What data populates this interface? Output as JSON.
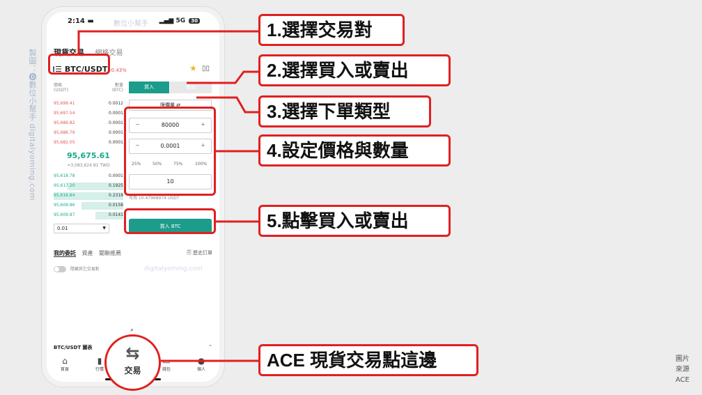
{
  "side_watermark": "製圖：🅓數位小幫手 digitalyoming.com",
  "status": {
    "time": "2:14 ▬",
    "brand": "數位小幫手",
    "signal": "▂▄▆ 5G",
    "battery": "30"
  },
  "tabs": {
    "spot": "現貨交易",
    "grid": "網格交易"
  },
  "pair": {
    "symbol": "⁞☰ BTC/USDT",
    "change": "-0.43%"
  },
  "icons": {
    "favorite": "star-icon",
    "chart": "candlestick-icon"
  },
  "orderbook": {
    "header": {
      "price": "價格",
      "price_unit": "(USDT)",
      "qty": "數量",
      "qty_unit": "(BTC)"
    },
    "sells": [
      {
        "price": "95,699.41",
        "qty": "0.0012"
      },
      {
        "price": "95,697.54",
        "qty": "0.0001"
      },
      {
        "price": "95,686.82",
        "qty": "0.0001"
      },
      {
        "price": "95,686.79",
        "qty": "0.0001"
      },
      {
        "price": "95,682.05",
        "qty": "0.0001"
      }
    ],
    "mid_price": "95,675.61",
    "mid_twd": "≈3,083,624.81 TWD",
    "buys": [
      {
        "price": "95,618.78",
        "qty": "0.0001",
        "depth": 0.0
      },
      {
        "price": "95,617.20",
        "qty": "0.1925",
        "depth": 0.8
      },
      {
        "price": "95,616.84",
        "qty": "0.2318",
        "depth": 1.0
      },
      {
        "price": "95,609.86",
        "qty": "0.0158",
        "depth": 0.6
      },
      {
        "price": "95,609.87",
        "qty": "0.0141",
        "depth": 0.4
      }
    ],
    "precision": "0.01"
  },
  "form": {
    "buy_tab": "買入",
    "sell_tab": "賣出",
    "order_type": "限價單 ⇄",
    "price": "80000",
    "amount": "0.0001",
    "minus": "−",
    "plus": "+",
    "percents": [
      "25%",
      "50%",
      "75%",
      "100%"
    ],
    "total": "10",
    "available": "可用 10.47968974 USDT",
    "submit": "買入 BTC"
  },
  "lower": {
    "my_orders": "我的委託",
    "assets": "資產",
    "bots": "關聯推薦",
    "history": "🗐 歷史訂單",
    "hide_other": "隱藏其它交易對"
  },
  "url_watermark": "digitalyoming.com",
  "chart_bar": {
    "label": "BTC/USDT 圖表",
    "expand": "⌃"
  },
  "nav": {
    "home": "首頁",
    "market": "行情",
    "wallet": "錢包",
    "account": "個人",
    "trade": "交易",
    "trade_icon": "⇆"
  },
  "callouts": {
    "step1": "1.選擇交易對",
    "step2": "2.選擇買入或賣出",
    "step3": "3.選擇下單類型",
    "step4": "4.設定價格與數量",
    "step5": "5.點擊買入或賣出",
    "ace": "ACE 現貨交易點這邊"
  },
  "source": [
    "圖片",
    "來源",
    "ACE"
  ],
  "colors": {
    "accent": "#1c9c8a",
    "highlight": "#e02020",
    "sell": "#e05555",
    "buy": "#1aa88e"
  }
}
